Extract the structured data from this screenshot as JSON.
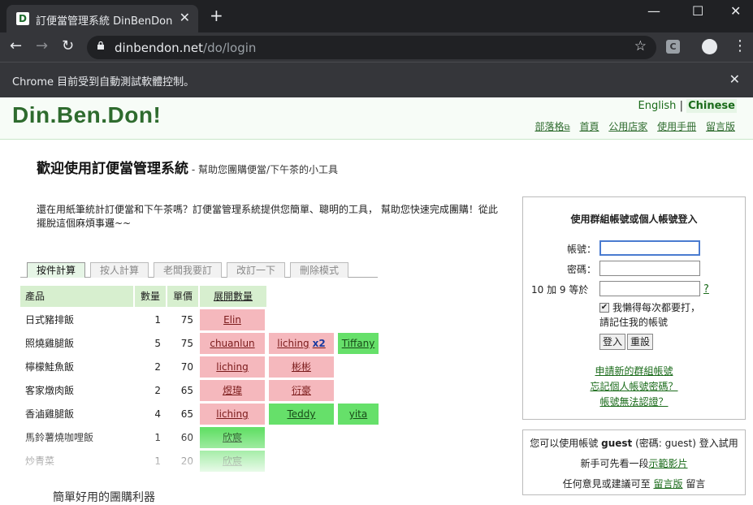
{
  "browser": {
    "tab_title": "訂便當管理系統 DinBenDon",
    "url_host": "dinbendon.net",
    "url_path": "/do/login",
    "info_message": "Chrome 目前受到自動測試軟體控制。"
  },
  "header": {
    "logo": "Din.Ben.Don!",
    "lang_en": "English",
    "lang_sep": "|",
    "lang_zh": "Chinese",
    "nav": [
      "部落格",
      "首頁",
      "公用店家",
      "使用手冊",
      "留言版"
    ]
  },
  "main": {
    "title": "歡迎使用訂便當管理系統",
    "subtitle": " - 幫助您團購便當/下午茶的小工具",
    "intro": "還在用紙筆統計訂便當和下午茶嗎？訂便當管理系統提供您簡單、聰明的工具， 幫助您快速完成團購！從此擺脫這個麻煩事邏~~",
    "tabs": [
      "按件計算",
      "按人計算",
      "老闆我要訂",
      "改訂一下",
      "刪除模式"
    ],
    "table": {
      "headers": [
        "產品",
        "數量",
        "單價",
        "展開數量"
      ],
      "rows": [
        {
          "name": "日式豬排飯",
          "qty": "1",
          "price": "75",
          "people": [
            {
              "n": "Elin",
              "c": "pink"
            }
          ]
        },
        {
          "name": "照燒雞腿飯",
          "qty": "5",
          "price": "75",
          "people": [
            {
              "n": "chuanlun",
              "c": "pink"
            },
            {
              "n": "liching",
              "c": "pink",
              "x": "x2"
            },
            {
              "n": "Tiffany",
              "c": "green"
            }
          ]
        },
        {
          "name": "檸檬鮭魚飯",
          "qty": "2",
          "price": "70",
          "people": [
            {
              "n": "liching",
              "c": "pink"
            },
            {
              "n": "彬彬",
              "c": "pink"
            }
          ]
        },
        {
          "name": "客家燉肉飯",
          "qty": "2",
          "price": "65",
          "people": [
            {
              "n": "煜瑋",
              "c": "pink"
            },
            {
              "n": "衍豪",
              "c": "pink"
            }
          ]
        },
        {
          "name": "香滷雞腿飯",
          "qty": "4",
          "price": "65",
          "people": [
            {
              "n": "liching",
              "c": "pink"
            },
            {
              "n": "Teddy",
              "c": "green"
            },
            {
              "n": "yita",
              "c": "green"
            }
          ]
        },
        {
          "name": "馬鈴薯燒咖哩飯",
          "qty": "1",
          "price": "60",
          "people": [
            {
              "n": "欣宸",
              "c": "green"
            }
          ]
        },
        {
          "name": "炒青菜",
          "qty": "1",
          "price": "20",
          "people": [
            {
              "n": "欣宸",
              "c": "green"
            }
          ]
        }
      ]
    },
    "slogan": "簡單好用的團購利器"
  },
  "login": {
    "title": "使用群組帳號或個人帳號登入",
    "account_label": "帳號：",
    "password_label": "密碼：",
    "captcha_label": "10 加 9 等於",
    "captcha_help": "?",
    "remember_text": "我懶得每次都要打，",
    "remember_text2": "請記住我的帳號",
    "login_button": "登入",
    "reset_button": "重設",
    "link_new_group": "申請新的群組帳號",
    "link_forgot": "忘記個人帳號密碼？",
    "link_cannot_verify": "帳號無法認證？"
  },
  "guest": {
    "line1_pre": "您可以使用帳號 ",
    "line1_user": "guest",
    "line1_post": " (密碼: guest) 登入試用",
    "line2_pre": "新手可先看一段",
    "line2_link": "示範影片",
    "line3_pre": "任何意見或建議可至 ",
    "line3_link": "留言版",
    "line3_post": " 留言"
  }
}
